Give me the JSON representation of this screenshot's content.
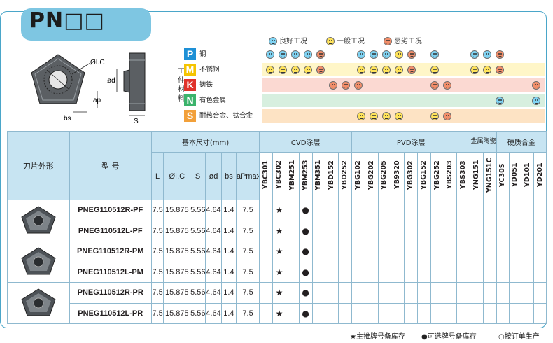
{
  "title": "PN□□",
  "diagram": {
    "labels": [
      "ØI.C",
      "Ød",
      "bs",
      "ap",
      "S"
    ]
  },
  "material_legend": {
    "side_label": [
      "工",
      "件",
      "材",
      "料"
    ],
    "ratings": [
      {
        "key": "good",
        "label": "良好工况"
      },
      {
        "key": "ok",
        "label": "一般工况"
      },
      {
        "key": "bad",
        "label": "恶劣工况"
      }
    ],
    "materials": [
      {
        "code": "P",
        "name": "钢",
        "color": "#1e90d6",
        "band": "#ffffff"
      },
      {
        "code": "M",
        "name": "不锈钢",
        "color": "#f5c400",
        "band": "#fff6c8"
      },
      {
        "code": "K",
        "name": "铸铁",
        "color": "#e0322b",
        "band": "#fbd9d2"
      },
      {
        "code": "N",
        "name": "有色金属",
        "color": "#3bb36b",
        "band": "#d7efdf"
      },
      {
        "code": "S",
        "name": "耐热合金、钛合金",
        "color": "#f2a03a",
        "band": "#fde3c4"
      }
    ]
  },
  "table": {
    "col_shape": "刀片外形",
    "col_model": "型  号",
    "dim_group": "基本尺寸(mm)",
    "dim_cols": [
      "L",
      "ØI.C",
      "S",
      "ød",
      "bs",
      "aPmax"
    ],
    "grade_groups": [
      {
        "name": "CVD涂层",
        "grades": [
          "YBC301",
          "YBC302",
          "YBM251",
          "YBM253",
          "YBM351",
          "YBD152",
          "YBD252"
        ]
      },
      {
        "name": "PVD涂层",
        "grades": [
          "YBG102",
          "YBG202",
          "YBG205",
          "YB9320",
          "YBG302",
          "YBG152",
          "YBG252",
          "YBS203",
          "YBS303"
        ]
      },
      {
        "name": "金属陶瓷",
        "grades": [
          "YNG151",
          "YNG151C"
        ]
      },
      {
        "name": "硬质合金",
        "grades": [
          "YC30S",
          "YD051",
          "YD101",
          "YD201"
        ]
      }
    ],
    "rows": [
      {
        "model": "PNEG110512R-PF",
        "L": "7.5",
        "IC": "15.875",
        "S": "5.56",
        "d": "4.64",
        "bs": "1.4",
        "ap": "7.5",
        "marks": {
          "YBC302": "★",
          "YBM253": "●"
        }
      },
      {
        "model": "PNEG110512L-PF",
        "L": "7.5",
        "IC": "15.875",
        "S": "5.56",
        "d": "4.64",
        "bs": "1.4",
        "ap": "7.5",
        "marks": {
          "YBC302": "★",
          "YBM253": "●"
        }
      },
      {
        "model": "PNEG110512R-PM",
        "L": "7.5",
        "IC": "15.875",
        "S": "5.56",
        "d": "4.64",
        "bs": "1.4",
        "ap": "7.5",
        "marks": {
          "YBC302": "★",
          "YBM253": "●"
        }
      },
      {
        "model": "PNEG110512L-PM",
        "L": "7.5",
        "IC": "15.875",
        "S": "5.56",
        "d": "4.64",
        "bs": "1.4",
        "ap": "7.5",
        "marks": {
          "YBC302": "★",
          "YBM253": "●"
        }
      },
      {
        "model": "PNEG110512R-PR",
        "L": "7.5",
        "IC": "15.875",
        "S": "5.56",
        "d": "4.64",
        "bs": "1.4",
        "ap": "7.5",
        "marks": {
          "YBC302": "★",
          "YBM253": "●"
        }
      },
      {
        "model": "PNEG110512L-PR",
        "L": "7.5",
        "IC": "15.875",
        "S": "5.56",
        "d": "4.64",
        "bs": "1.4",
        "ap": "7.5",
        "marks": {
          "YBC302": "★",
          "YBM253": "●"
        }
      }
    ]
  },
  "footnotes": [
    "★主推牌号备库存",
    "●可选牌号备库存",
    "○按订单生产"
  ]
}
